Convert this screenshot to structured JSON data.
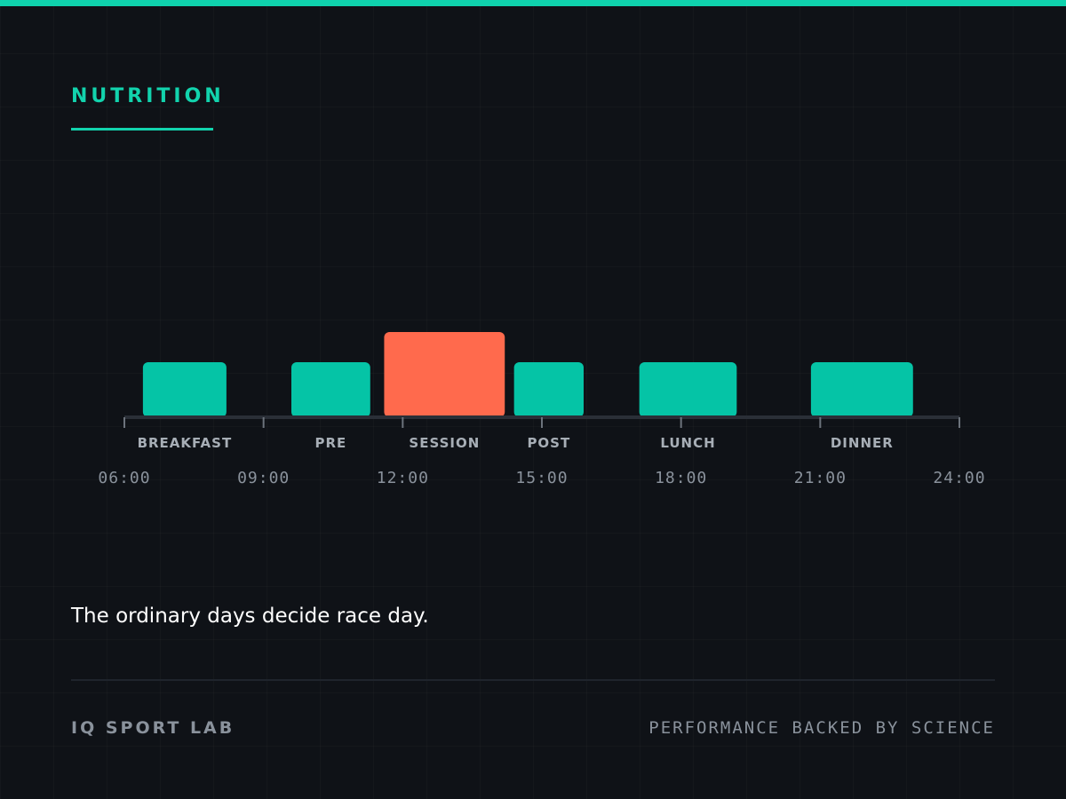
{
  "header": {
    "title": "NUTRITION"
  },
  "colors": {
    "accent": "#12d3ad",
    "meal": "#05c4a6",
    "session": "#ff6a4d",
    "axis": "#2a2f37",
    "label": "#a7aeb6",
    "tick_label": "#8a929c"
  },
  "chart_data": {
    "type": "timeline",
    "x_unit": "hour of day",
    "xlim": [
      6,
      24
    ],
    "ticks": [
      {
        "value": 6,
        "label": "06:00"
      },
      {
        "value": 9,
        "label": "09:00"
      },
      {
        "value": 12,
        "label": "12:00"
      },
      {
        "value": 15,
        "label": "15:00"
      },
      {
        "value": 18,
        "label": "18:00"
      },
      {
        "value": 21,
        "label": "21:00"
      },
      {
        "value": 24,
        "label": "24:00"
      }
    ],
    "events": [
      {
        "label": "BREAKFAST",
        "start": 6.4,
        "end": 8.2,
        "kind": "meal"
      },
      {
        "label": "PRE",
        "start": 9.6,
        "end": 11.3,
        "kind": "meal"
      },
      {
        "label": "SESSION",
        "start": 11.6,
        "end": 14.2,
        "kind": "session"
      },
      {
        "label": "POST",
        "start": 14.4,
        "end": 15.9,
        "kind": "meal"
      },
      {
        "label": "LUNCH",
        "start": 17.1,
        "end": 19.2,
        "kind": "meal"
      },
      {
        "label": "DINNER",
        "start": 20.8,
        "end": 23.0,
        "kind": "meal"
      }
    ]
  },
  "tagline": "The ordinary days decide race day.",
  "footer": {
    "brand": "IQ SPORT LAB",
    "slogan": "PERFORMANCE BACKED BY SCIENCE"
  }
}
